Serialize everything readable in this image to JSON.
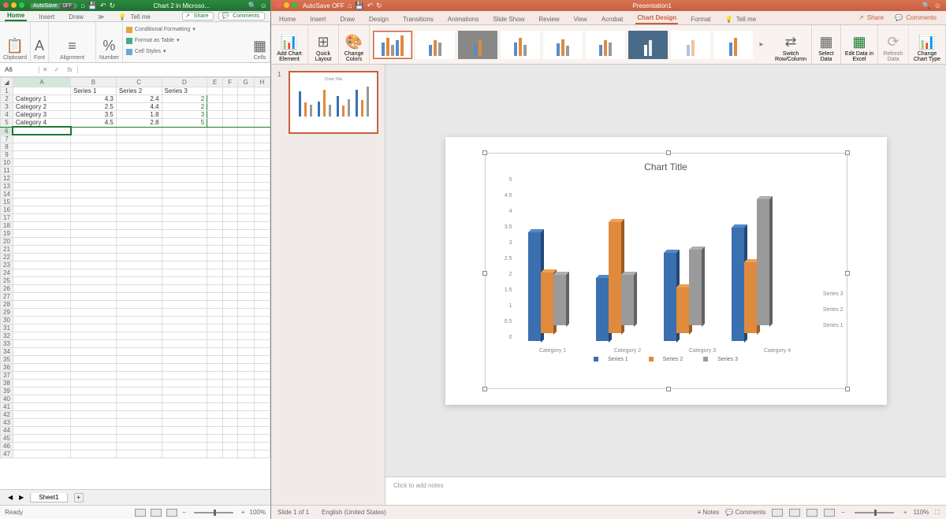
{
  "excel": {
    "autosave_label": "AutoSave",
    "autosave_state": "OFF",
    "title": "Chart 2 in Microso...",
    "tabs": [
      "Home",
      "Insert",
      "Draw"
    ],
    "tell_me": "Tell me",
    "share": "Share",
    "comments": "Comments",
    "ribbon": {
      "clipboard": "Clipboard",
      "font": "Font",
      "alignment": "Alignment",
      "number": "Number",
      "cf": "Conditional Formatting",
      "fat": "Format as Table",
      "cs": "Cell Styles",
      "cells": "Cells"
    },
    "namebox": "A6",
    "fx": "fx",
    "columns": [
      "A",
      "B",
      "C",
      "D",
      "E",
      "F",
      "G",
      "H"
    ],
    "headers": [
      "",
      "Series 1",
      "Series 2",
      "Series 3"
    ],
    "rows": [
      {
        "label": "Category 1",
        "s1": "4.3",
        "s2": "2.4",
        "s3": "2"
      },
      {
        "label": "Category 2",
        "s1": "2.5",
        "s2": "4.4",
        "s3": "2"
      },
      {
        "label": "Category 3",
        "s1": "3.5",
        "s2": "1.8",
        "s3": "3"
      },
      {
        "label": "Category 4",
        "s1": "4.5",
        "s2": "2.8",
        "s3": "5"
      }
    ],
    "sheet": "Sheet1",
    "status": "Ready",
    "zoom": "100%"
  },
  "ppt": {
    "autosave_label": "AutoSave",
    "autosave_state": "OFF",
    "title": "Presentation1",
    "tabs": [
      "Home",
      "Insert",
      "Draw",
      "Design",
      "Transitions",
      "Animations",
      "Slide Show",
      "Review",
      "View",
      "Acrobat",
      "Chart Design",
      "Format"
    ],
    "active_tab": "Chart Design",
    "tell_me": "Tell me",
    "share": "Share",
    "comments": "Comments",
    "ribbon": {
      "add": "Add Chart Element",
      "quick": "Quick Layout",
      "colors": "Change Colors",
      "switch": "Switch Row/Column",
      "select": "Select Data",
      "edit": "Edit Data in Excel",
      "refresh": "Refresh Data",
      "type": "Change Chart Type"
    },
    "thumb_num": "1",
    "chart_title": "Chart Title",
    "yticks": [
      "0",
      "0.5",
      "1",
      "1.5",
      "2",
      "2.5",
      "3",
      "3.5",
      "4",
      "4.5",
      "5"
    ],
    "categories": [
      "Category 1",
      "Category 2",
      "Category 3",
      "Category 4"
    ],
    "series": [
      "Series 1",
      "Series 2",
      "Series 3"
    ],
    "notes": "Click to add notes",
    "status": "Slide 1 of 1",
    "lang": "English (United States)",
    "notes_btn": "Notes",
    "comments_btn": "Comments",
    "zoom": "110%"
  },
  "chart_data": {
    "type": "bar",
    "title": "Chart Title",
    "categories": [
      "Category 1",
      "Category 2",
      "Category 3",
      "Category 4"
    ],
    "series": [
      {
        "name": "Series 1",
        "values": [
          4.3,
          2.5,
          3.5,
          4.5
        ]
      },
      {
        "name": "Series 2",
        "values": [
          2.4,
          4.4,
          1.8,
          2.8
        ]
      },
      {
        "name": "Series 3",
        "values": [
          2,
          2,
          3,
          5
        ]
      }
    ],
    "ylim": [
      0,
      5
    ],
    "xlabel": "",
    "ylabel": ""
  }
}
